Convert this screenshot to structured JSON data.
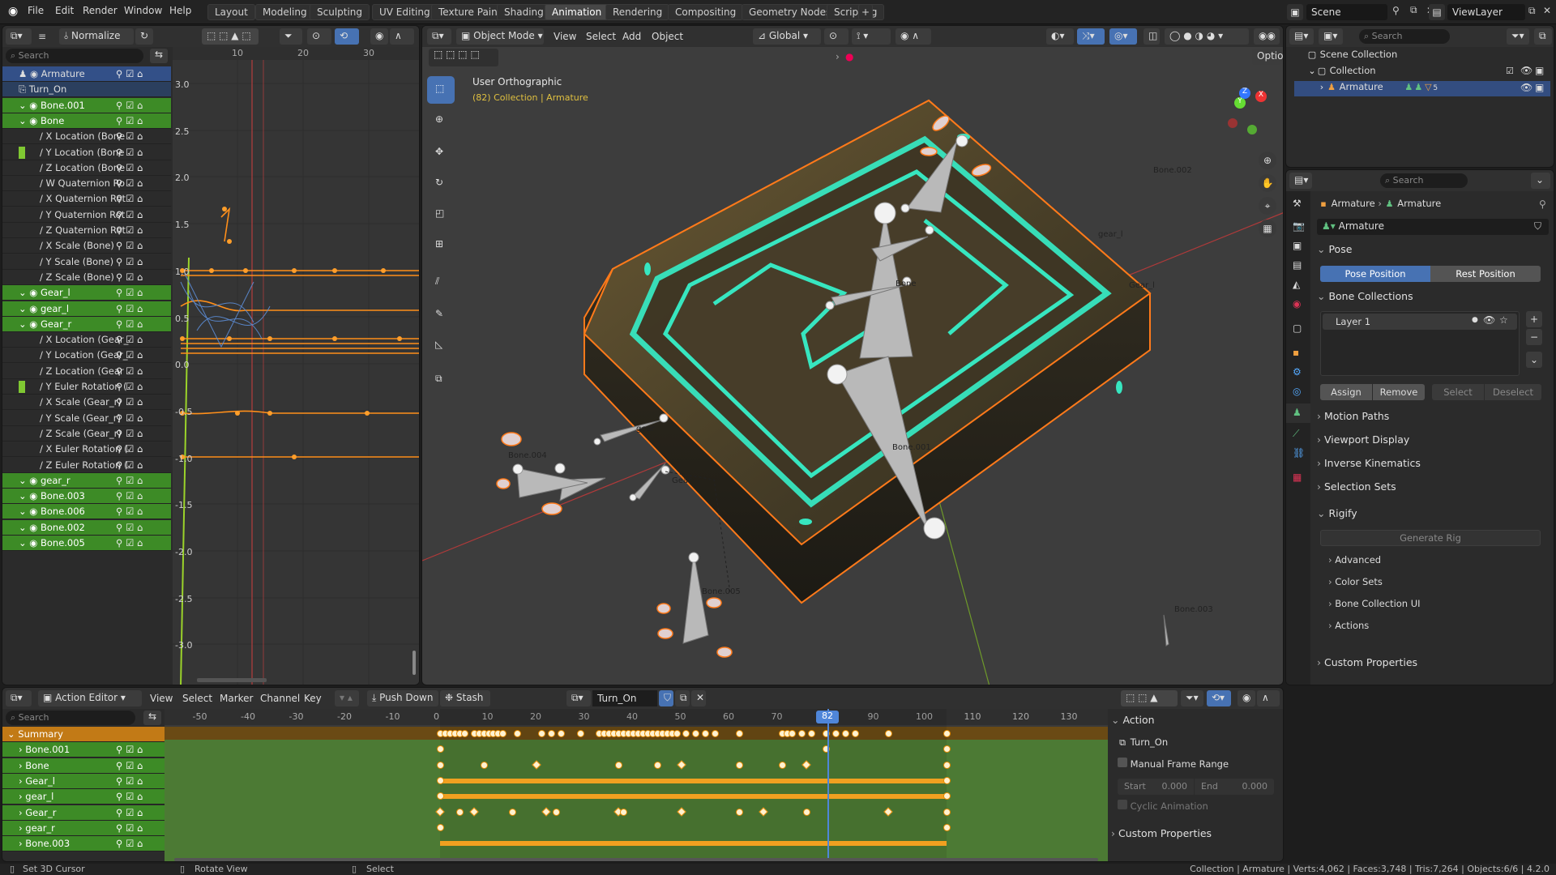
{
  "topbar": {
    "menus": [
      "File",
      "Edit",
      "Render",
      "Window",
      "Help"
    ],
    "workspaces": [
      "Layout",
      "Modeling",
      "Sculpting",
      "UV Editing",
      "Texture Paint",
      "Shading",
      "Animation",
      "Rendering",
      "Compositing",
      "Geometry Nodes",
      "Scripting"
    ],
    "active_workspace": "Animation",
    "add_tab": "+",
    "scene_label": "Scene",
    "viewlayer_label": "ViewLayer"
  },
  "graph": {
    "normalize_label": "Normalize",
    "search_placeholder": "Search",
    "ruler": [
      "10",
      "20",
      "30"
    ],
    "yticks": [
      "3.0",
      "2.5",
      "2.0",
      "1.5",
      "1.0",
      "0.5",
      "0.0",
      "-0.5",
      "-1.0",
      "-1.5",
      "-2.0",
      "-2.5",
      "-3.0"
    ],
    "channels": [
      {
        "label": "Armature",
        "kind": "object"
      },
      {
        "label": "Turn_On",
        "kind": "action"
      },
      {
        "label": "Bone.001",
        "kind": "group"
      },
      {
        "label": "Bone",
        "kind": "group"
      },
      {
        "label": "X Location (Bone",
        "kind": "curve"
      },
      {
        "label": "Y Location (Bone",
        "kind": "curve-hl"
      },
      {
        "label": "Z Location (Bone",
        "kind": "curve"
      },
      {
        "label": "W Quaternion Ro",
        "kind": "curve"
      },
      {
        "label": "X Quaternion Rot",
        "kind": "curve"
      },
      {
        "label": "Y Quaternion Rot",
        "kind": "curve"
      },
      {
        "label": "Z Quaternion Rot",
        "kind": "curve"
      },
      {
        "label": "X Scale (Bone)",
        "kind": "curve"
      },
      {
        "label": "Y Scale (Bone)",
        "kind": "curve"
      },
      {
        "label": "Z Scale (Bone)",
        "kind": "curve"
      },
      {
        "label": "Gear_l",
        "kind": "group"
      },
      {
        "label": "gear_l",
        "kind": "group"
      },
      {
        "label": "Gear_r",
        "kind": "group"
      },
      {
        "label": "X Location (Gear_",
        "kind": "curve"
      },
      {
        "label": "Y Location (Gear_",
        "kind": "curve"
      },
      {
        "label": "Z Location (Gear",
        "kind": "curve"
      },
      {
        "label": "Y Euler Rotation (",
        "kind": "curve-hl"
      },
      {
        "label": "X Scale (Gear_r)",
        "kind": "curve"
      },
      {
        "label": "Y Scale (Gear_r)",
        "kind": "curve"
      },
      {
        "label": "Z Scale (Gear_r)",
        "kind": "curve"
      },
      {
        "label": "X Euler Rotation (",
        "kind": "curve"
      },
      {
        "label": "Z Euler Rotation (",
        "kind": "curve"
      },
      {
        "label": "gear_r",
        "kind": "group"
      },
      {
        "label": "Bone.003",
        "kind": "group"
      },
      {
        "label": "Bone.006",
        "kind": "group"
      },
      {
        "label": "Bone.002",
        "kind": "group"
      },
      {
        "label": "Bone.005",
        "kind": "group"
      }
    ]
  },
  "viewport": {
    "mode": "Object Mode",
    "menus": [
      "View",
      "Select",
      "Add",
      "Object"
    ],
    "orientation": "Global",
    "options": "Options",
    "view_name": "User Orthographic",
    "view_info": "(82) Collection | Armature",
    "bone_labels": [
      "Bone.002",
      "gear_l",
      "Gear_l",
      "Bone",
      "Bone.001",
      "Bone.004",
      "gear",
      "Gear",
      "Bone.005",
      "Bone.003"
    ],
    "axis_labels": [
      "X",
      "Y",
      "Z"
    ],
    "colors": {
      "bg": "#3d3d3d",
      "grid_x": "#b03a3a",
      "grid_y": "#6e9a2a",
      "outline": "#ff7a1a",
      "glow": "#37e6c0"
    }
  },
  "outliner": {
    "search_placeholder": "Search",
    "items": [
      "Scene Collection",
      "Collection",
      "Armature"
    ],
    "badge": "5"
  },
  "properties": {
    "search_placeholder": "Search",
    "breadcrumb": [
      "Armature",
      "Armature"
    ],
    "datablock": "Armature",
    "pose_header": "Pose",
    "pose_position": "Pose Position",
    "rest_position": "Rest Position",
    "bone_collections_header": "Bone Collections",
    "layer_name": "Layer 1",
    "assign": "Assign",
    "remove": "Remove",
    "select": "Select",
    "deselect": "Deselect",
    "sections": [
      "Motion Paths",
      "Viewport Display",
      "Inverse Kinematics",
      "Selection Sets"
    ],
    "rigify_header": "Rigify",
    "generate_rig": "Generate Rig",
    "rigify_subs": [
      "Advanced",
      "Color Sets",
      "Bone Collection UI",
      "Actions"
    ],
    "custom_properties": "Custom Properties"
  },
  "dopesheet": {
    "editor_type": "Action Editor",
    "menus": [
      "View",
      "Select",
      "Marker",
      "Channel",
      "Key"
    ],
    "push_down": "Push Down",
    "stash": "Stash",
    "action_name": "Turn_On",
    "search_placeholder": "Search",
    "ruler": [
      "-50",
      "-40",
      "-30",
      "-20",
      "-10",
      "0",
      "10",
      "20",
      "30",
      "40",
      "50",
      "60",
      "70",
      "80",
      "90",
      "100",
      "110",
      "120",
      "130"
    ],
    "current_frame": "82",
    "channels": [
      "Summary",
      "Bone.001",
      "Bone",
      "Gear_l",
      "gear_l",
      "Gear_r",
      "gear_r",
      "Bone.003"
    ],
    "keys": {
      "summary": [
        0,
        1,
        2,
        3,
        4,
        5,
        7,
        8,
        9,
        10,
        11,
        12,
        13,
        16,
        21,
        23,
        25,
        29,
        33,
        34,
        35,
        36,
        37,
        38,
        39,
        40,
        41,
        42,
        43,
        44,
        45,
        46,
        47,
        48,
        49,
        51,
        53,
        55,
        57,
        62,
        71,
        72,
        73,
        75,
        77,
        80,
        82,
        84,
        86,
        93,
        105
      ],
      "bone001": [
        0,
        80,
        105
      ],
      "bone": [
        0,
        9,
        20,
        37,
        45,
        50,
        62,
        71,
        76,
        105
      ],
      "gear_l_range": [
        0,
        105
      ],
      "gear_l2_range": [
        0,
        105
      ],
      "gear_r": [
        0,
        4,
        7,
        15,
        22,
        24,
        37,
        38,
        50,
        62,
        67,
        76,
        93,
        105
      ],
      "gear_r2": [
        0,
        105
      ]
    },
    "side": {
      "action_header": "Action",
      "action_name": "Turn_On",
      "manual_frame_range": "Manual Frame Range",
      "start_label": "Start",
      "start_value": "0.000",
      "end_label": "End",
      "end_value": "0.000",
      "cyclic": "Cyclic Animation",
      "custom_properties": "Custom Properties"
    }
  },
  "statusbar": {
    "left": [
      "Set 3D Cursor",
      "Rotate View",
      "Select"
    ],
    "right": "Collection | Armature | Verts:4,062 | Faces:3,748 | Tris:7,264 | Objects:6/6 | 4.2.0"
  }
}
